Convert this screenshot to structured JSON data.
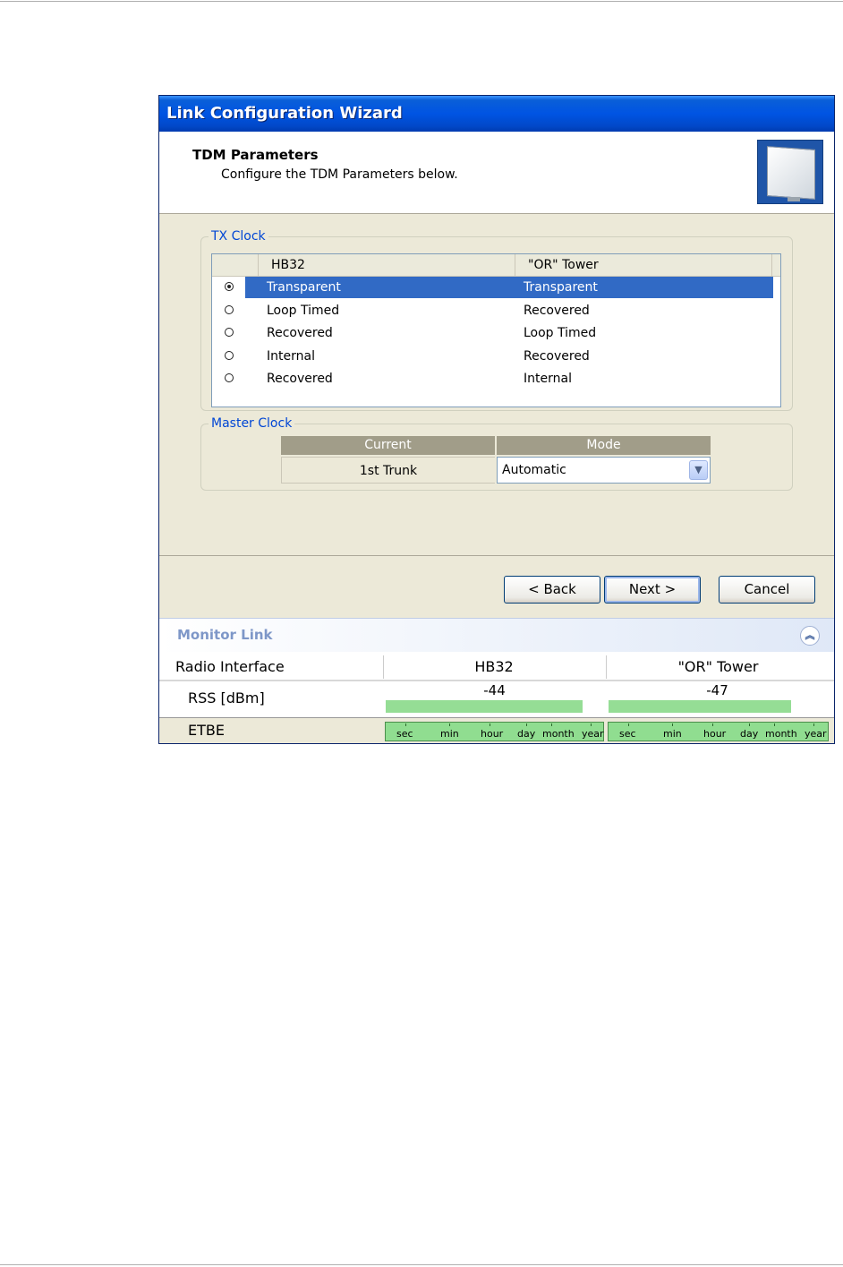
{
  "window": {
    "title": "Link Configuration Wizard"
  },
  "header": {
    "title": "TDM Parameters",
    "subtitle": "Configure the TDM Parameters below."
  },
  "tx_clock": {
    "label": "TX Clock",
    "columns": [
      "",
      "HB32",
      "\"OR\" Tower"
    ],
    "rows": [
      {
        "selected": true,
        "site_a": "Transparent",
        "site_b": "Transparent"
      },
      {
        "selected": false,
        "site_a": "Loop Timed",
        "site_b": "Recovered"
      },
      {
        "selected": false,
        "site_a": "Recovered",
        "site_b": "Loop Timed"
      },
      {
        "selected": false,
        "site_a": "Internal",
        "site_b": "Recovered"
      },
      {
        "selected": false,
        "site_a": "Recovered",
        "site_b": "Internal"
      }
    ]
  },
  "master_clock": {
    "label": "Master Clock",
    "columns": {
      "current": "Current",
      "mode": "Mode"
    },
    "current_value": "1st Trunk",
    "mode_value": "Automatic"
  },
  "buttons": {
    "back": "< Back",
    "next": "Next >",
    "cancel": "Cancel"
  },
  "monitor": {
    "title": "Monitor Link",
    "headers": [
      "Radio Interface",
      "HB32",
      "\"OR\" Tower"
    ],
    "rss_label": "RSS [dBm]",
    "rss_values": [
      "-44",
      "-47"
    ],
    "rss_fill": [
      0.95,
      0.88
    ],
    "etbe_label": "ETBE",
    "etbe_units": [
      "sec",
      "min",
      "hour",
      "day",
      "month",
      "year"
    ]
  },
  "colors": {
    "title_bar": "#0054e3",
    "selection": "#316ac5",
    "group_label": "#0046d5",
    "good_bar": "#95dd95"
  },
  "icons": {
    "wizard_logo": "antenna-panel-icon",
    "collapse": "double-chevron-up-icon",
    "dropdown": "chevron-down-icon"
  }
}
